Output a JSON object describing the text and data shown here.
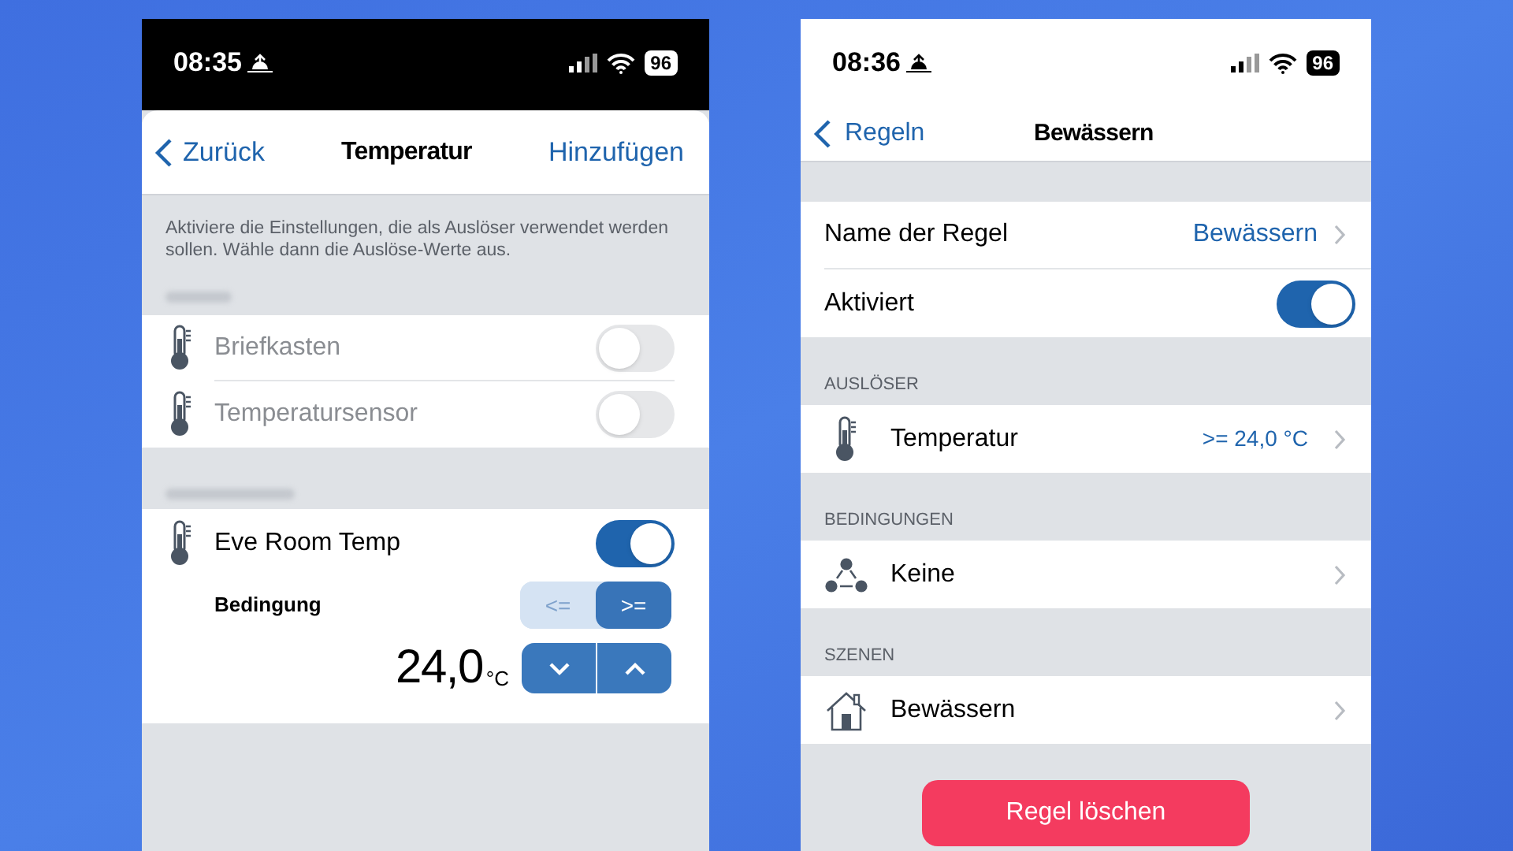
{
  "left_phone": {
    "status_bar": {
      "time": "08:35",
      "battery": "96"
    },
    "nav": {
      "back": "Zurück",
      "title": "Temperatur",
      "action": "Hinzufügen"
    },
    "description": "Aktiviere die Einstellungen, die als Auslöser verwendet werden sollen. Wähle dann die Auslöse-Werte aus.",
    "sensors": [
      {
        "name": "Briefkasten",
        "on": false
      },
      {
        "name": "Temperatursensor",
        "on": false
      }
    ],
    "device": {
      "name": "Eve Room Temp",
      "on": true,
      "condition_label": "Bedingung",
      "options": [
        {
          "label": "<=",
          "selected": false
        },
        {
          "label": ">=",
          "selected": true
        }
      ],
      "value": "24,0",
      "unit": "°C"
    }
  },
  "right_phone": {
    "status_bar": {
      "time": "08:36",
      "battery": "96"
    },
    "nav": {
      "back": "Regeln",
      "title": "Bewässern"
    },
    "rule_rows": [
      {
        "kind": "value",
        "label": "Name der Regel",
        "value": "Bewässern"
      },
      {
        "kind": "toggle",
        "label": "Aktiviert",
        "on": true
      }
    ],
    "sections": [
      {
        "header": "AUSLÖSER",
        "rows": [
          {
            "kind": "thermometer",
            "label": "Temperatur",
            "value": ">= 24,0 °C"
          }
        ]
      },
      {
        "header": "BEDINGUNGEN",
        "rows": [
          {
            "kind": "network",
            "label": "Keine"
          }
        ]
      },
      {
        "header": "SZENEN",
        "rows": [
          {
            "kind": "house",
            "label": "Bewässern"
          }
        ]
      }
    ],
    "delete_button": "Regel löschen"
  }
}
